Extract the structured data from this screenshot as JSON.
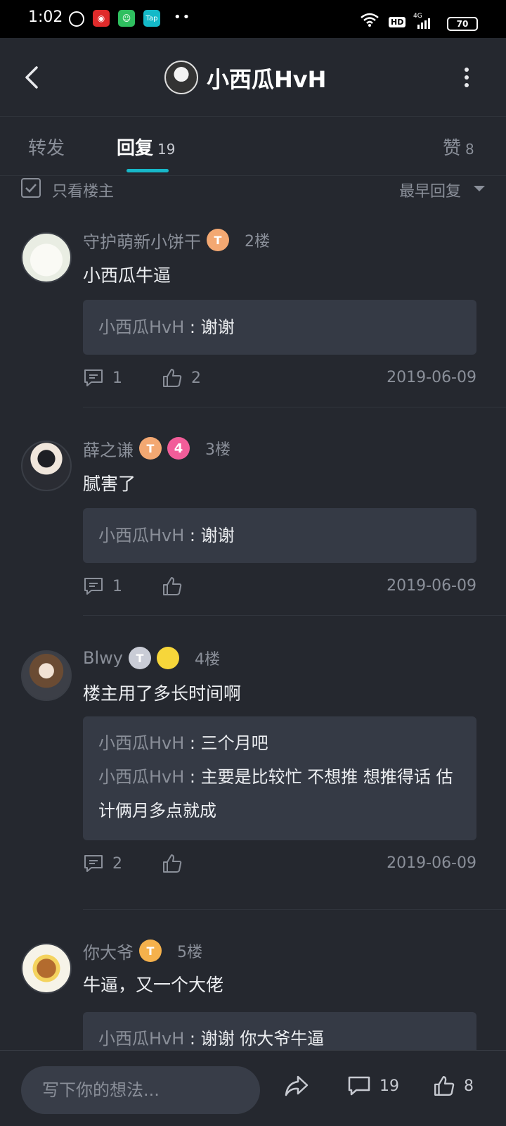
{
  "status_bar": {
    "time": "1:02",
    "app_icons": [
      "alarm-icon",
      "netease-music-icon",
      "wechat-icon",
      "taptap-icon"
    ],
    "taptap_label": "Tap",
    "more_indicator": "••",
    "network_label": "4G",
    "hd_label": "HD",
    "battery": "70"
  },
  "header": {
    "title": "小西瓜HvH"
  },
  "tabs": {
    "repost": {
      "label": "转发"
    },
    "reply": {
      "label": "回复",
      "count": "19"
    },
    "like": {
      "label": "赞",
      "count": "8"
    },
    "active": "reply",
    "accent_color": "#17b8c9"
  },
  "filter": {
    "owner_only_label": "只看楼主",
    "sort_label": "最早回复"
  },
  "comments": [
    {
      "username": "守护萌新小饼干",
      "badges": [
        {
          "text": "T",
          "type": "peach"
        }
      ],
      "floor": "2楼",
      "text": "小西瓜牛逼",
      "replies": [
        {
          "author": "小西瓜HvH",
          "sep": " : ",
          "text": "谢谢"
        }
      ],
      "comment_count": "1",
      "like_count": "2",
      "date": "2019-06-09"
    },
    {
      "username": "薛之谦",
      "badges": [
        {
          "text": "T",
          "type": "peach"
        },
        {
          "text": "4",
          "type": "pink"
        }
      ],
      "floor": "3楼",
      "text": "腻害了",
      "replies": [
        {
          "author": "小西瓜HvH",
          "sep": " : ",
          "text": "谢谢"
        }
      ],
      "comment_count": "1",
      "like_count": "",
      "date": "2019-06-09"
    },
    {
      "username": "Blwy",
      "badges": [
        {
          "text": "T",
          "type": "silver"
        },
        {
          "text": "",
          "type": "yellow"
        }
      ],
      "floor": "4楼",
      "text": "楼主用了多长时间啊",
      "replies": [
        {
          "author": "小西瓜HvH",
          "sep": " : ",
          "text": "三个月吧"
        },
        {
          "author": "小西瓜HvH",
          "sep": " : ",
          "text": "主要是比较忙 不想推 想推得话 估计俩月多点就成"
        }
      ],
      "comment_count": "2",
      "like_count": "",
      "date": "2019-06-09"
    },
    {
      "username": "你大爷",
      "badges": [
        {
          "text": "T",
          "type": "gold"
        }
      ],
      "floor": "5楼",
      "text": "牛逼，又一个大佬",
      "replies": [
        {
          "author": "小西瓜HvH",
          "sep": " : ",
          "text": "谢谢 你大爷牛逼"
        }
      ]
    }
  ],
  "bottom_bar": {
    "input_placeholder": "写下你的想法...",
    "comment_count": "19",
    "like_count": "8"
  }
}
